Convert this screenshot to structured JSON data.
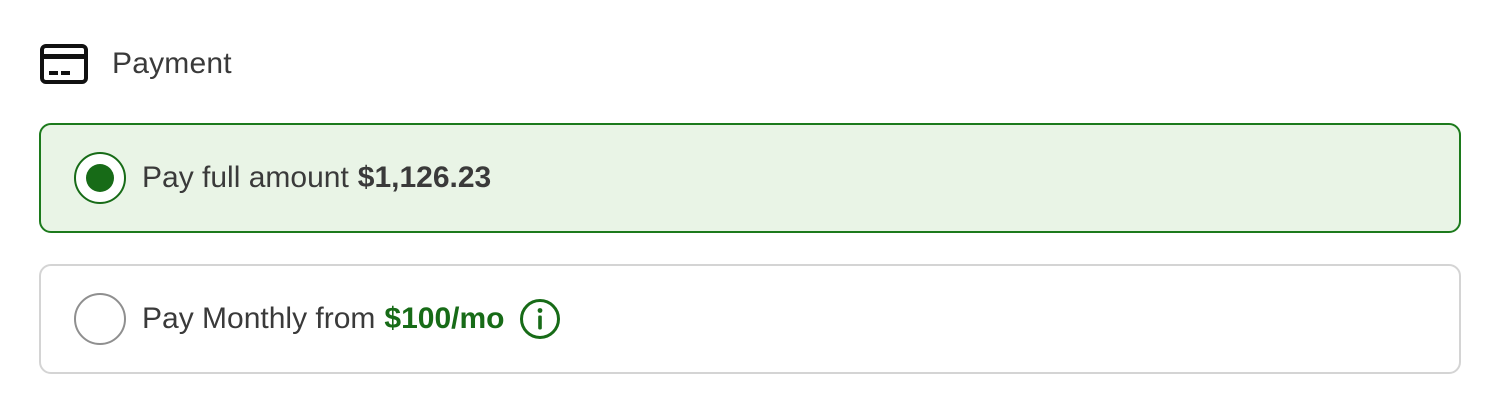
{
  "header": {
    "icon": "credit-card-icon",
    "title": "Payment"
  },
  "options": [
    {
      "label": "Pay full amount",
      "amount": "$1,126.23",
      "selected": true
    },
    {
      "label": "Pay Monthly from",
      "amount": "$100/mo",
      "selected": false,
      "info_icon": "info-icon"
    }
  ],
  "colors": {
    "accent": "#176b17",
    "selected_background": "#e9f4e6",
    "selected_border": "#1c7a1c",
    "unselected_border": "#d4d4d4",
    "text": "#3a3a3a"
  }
}
